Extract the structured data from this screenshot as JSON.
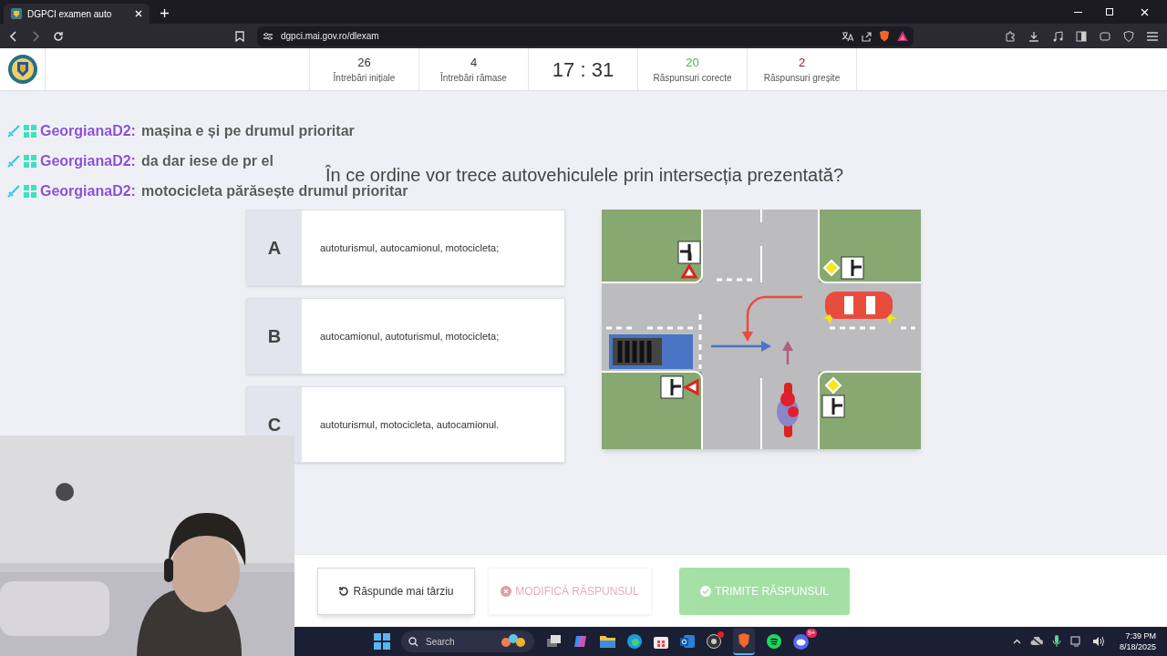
{
  "browser": {
    "tab_title": "DGPCI examen auto",
    "url": "dgpci.mai.gov.ro/dlexam"
  },
  "stats": [
    {
      "value": "26",
      "label": "Întrebări inițiale",
      "kind": "plain"
    },
    {
      "value": "4",
      "label": "Întrebări rămase",
      "kind": "plain"
    },
    {
      "value": "17 : 31",
      "kind": "timer"
    },
    {
      "value": "20",
      "label": "Răspunsuri corecte",
      "kind": "good"
    },
    {
      "value": "2",
      "label": "Răspunsuri greșite",
      "kind": "bad"
    }
  ],
  "chat": [
    {
      "user": "GeorgianaD2:",
      "message": "mașina e și pe drumul prioritar"
    },
    {
      "user": "GeorgianaD2:",
      "message": "da dar iese de pr el"
    },
    {
      "user": "GeorgianaD2:",
      "message": "motocicleta părăsește drumul prioritar"
    }
  ],
  "question": "În ce ordine vor trece autovehiculele prin intersecția prezentată?",
  "answers": [
    {
      "letter": "A",
      "text": "autoturismul, autocamionul, motocicleta;"
    },
    {
      "letter": "B",
      "text": "autocamionul, autoturismul, motocicleta;"
    },
    {
      "letter": "C",
      "text": "autoturismul, motocicleta, autocamionul."
    }
  ],
  "buttons": [
    {
      "label": "Răspunde mai târziu",
      "kind": "later",
      "disabled": false
    },
    {
      "label": "MODIFICĂ RĂSPUNSUL",
      "kind": "modify",
      "disabled": true
    },
    {
      "label": "TRIMITE RĂSPUNSUL",
      "kind": "submit",
      "disabled": true
    }
  ],
  "taskbar": {
    "search_placeholder": "Search",
    "notification_badge": "9+",
    "time": "7:39 PM",
    "date": "8/18/2025"
  }
}
